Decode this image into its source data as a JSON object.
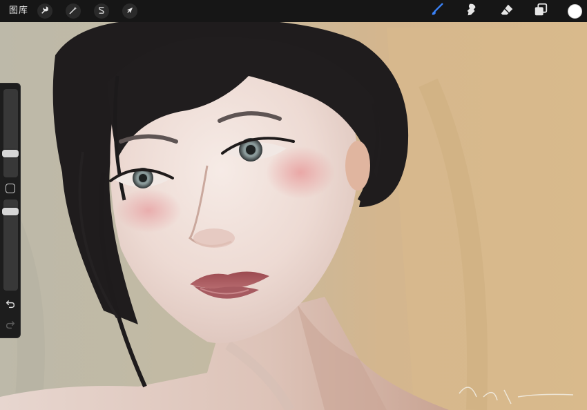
{
  "app": {
    "toolbar_left": {
      "gallery_label": "图库",
      "actions_icon": "wrench-icon",
      "adjustments_icon": "magic-wand-icon",
      "selection_icon": "selection-s-icon",
      "transform_icon": "cursor-arrow-icon"
    },
    "toolbar_right": {
      "brush_icon": "brush-icon",
      "smudge_icon": "smudge-icon",
      "eraser_icon": "eraser-icon",
      "layers_icon": "layers-icon",
      "current_color": "#ffffff"
    },
    "sidebar": {
      "brush_size_level": 0.25,
      "opacity_level": 0.9,
      "modify_icon": "square-icon",
      "undo_icon": "undo-icon",
      "redo_icon": "redo-icon"
    },
    "colors": {
      "toolbar_bg": "#161616",
      "brush_active": "#3a82f7",
      "icon": "#e6e6e6"
    }
  }
}
